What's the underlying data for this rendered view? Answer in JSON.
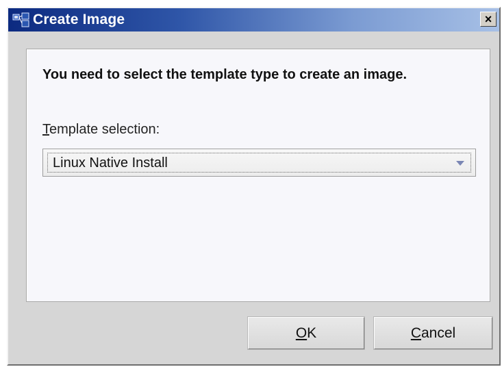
{
  "window": {
    "title": "Create Image",
    "close_glyph": "×"
  },
  "content": {
    "instruction": "You need to select the template type to create an image.",
    "template_label_mnemonic": "T",
    "template_label_rest": "emplate selection:",
    "template_value": "Linux Native Install"
  },
  "buttons": {
    "ok_mnemonic": "O",
    "ok_rest": "K",
    "cancel_mnemonic": "C",
    "cancel_rest": "ancel"
  },
  "icons": {
    "app": "network-app-icon",
    "close": "close-icon",
    "dropdown": "chevron-down-icon"
  },
  "colors": {
    "titlebar_start": "#0c2a80",
    "titlebar_end": "#a7c0e6",
    "window_bg": "#d6d6d6",
    "panel_bg": "#f7f7fb"
  }
}
